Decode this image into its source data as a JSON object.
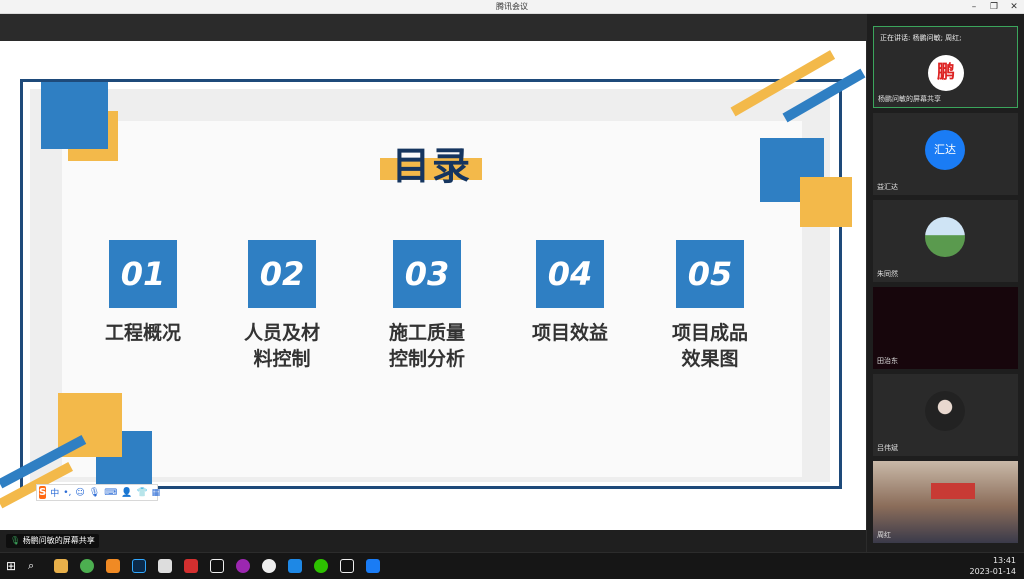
{
  "window": {
    "title": "腾讯会议",
    "min": "–",
    "max": "❐",
    "close": "✕"
  },
  "slide": {
    "title": "目录",
    "items": [
      {
        "num": "01",
        "label": "工程概况"
      },
      {
        "num": "02",
        "label": "人员及材\n料控制"
      },
      {
        "num": "03",
        "label": "施工质量\n控制分析"
      },
      {
        "num": "04",
        "label": "项目效益"
      },
      {
        "num": "05",
        "label": "项目成品\n效果图"
      }
    ],
    "colors": {
      "blue": "#2f7fc3",
      "navy": "#1e4a7a",
      "gold": "#f3b94a"
    }
  },
  "ime": {
    "logo": "S",
    "mode": "中"
  },
  "share": {
    "label": "杨鹏问敏的屏幕共享"
  },
  "panel": {
    "speaking": "正在讲话: 杨鹏问敏; 周红;",
    "tiles": [
      {
        "name": "杨鹏问敏的屏幕共享",
        "avatar_text": "鹏"
      },
      {
        "name": "益汇达",
        "avatar_text": "汇达"
      },
      {
        "name": "朱同然"
      },
      {
        "name": "田治东"
      },
      {
        "name": "吕伟斌"
      },
      {
        "name": "周红"
      }
    ]
  },
  "clock": {
    "time": "13:41",
    "date": "2023-01-14"
  }
}
